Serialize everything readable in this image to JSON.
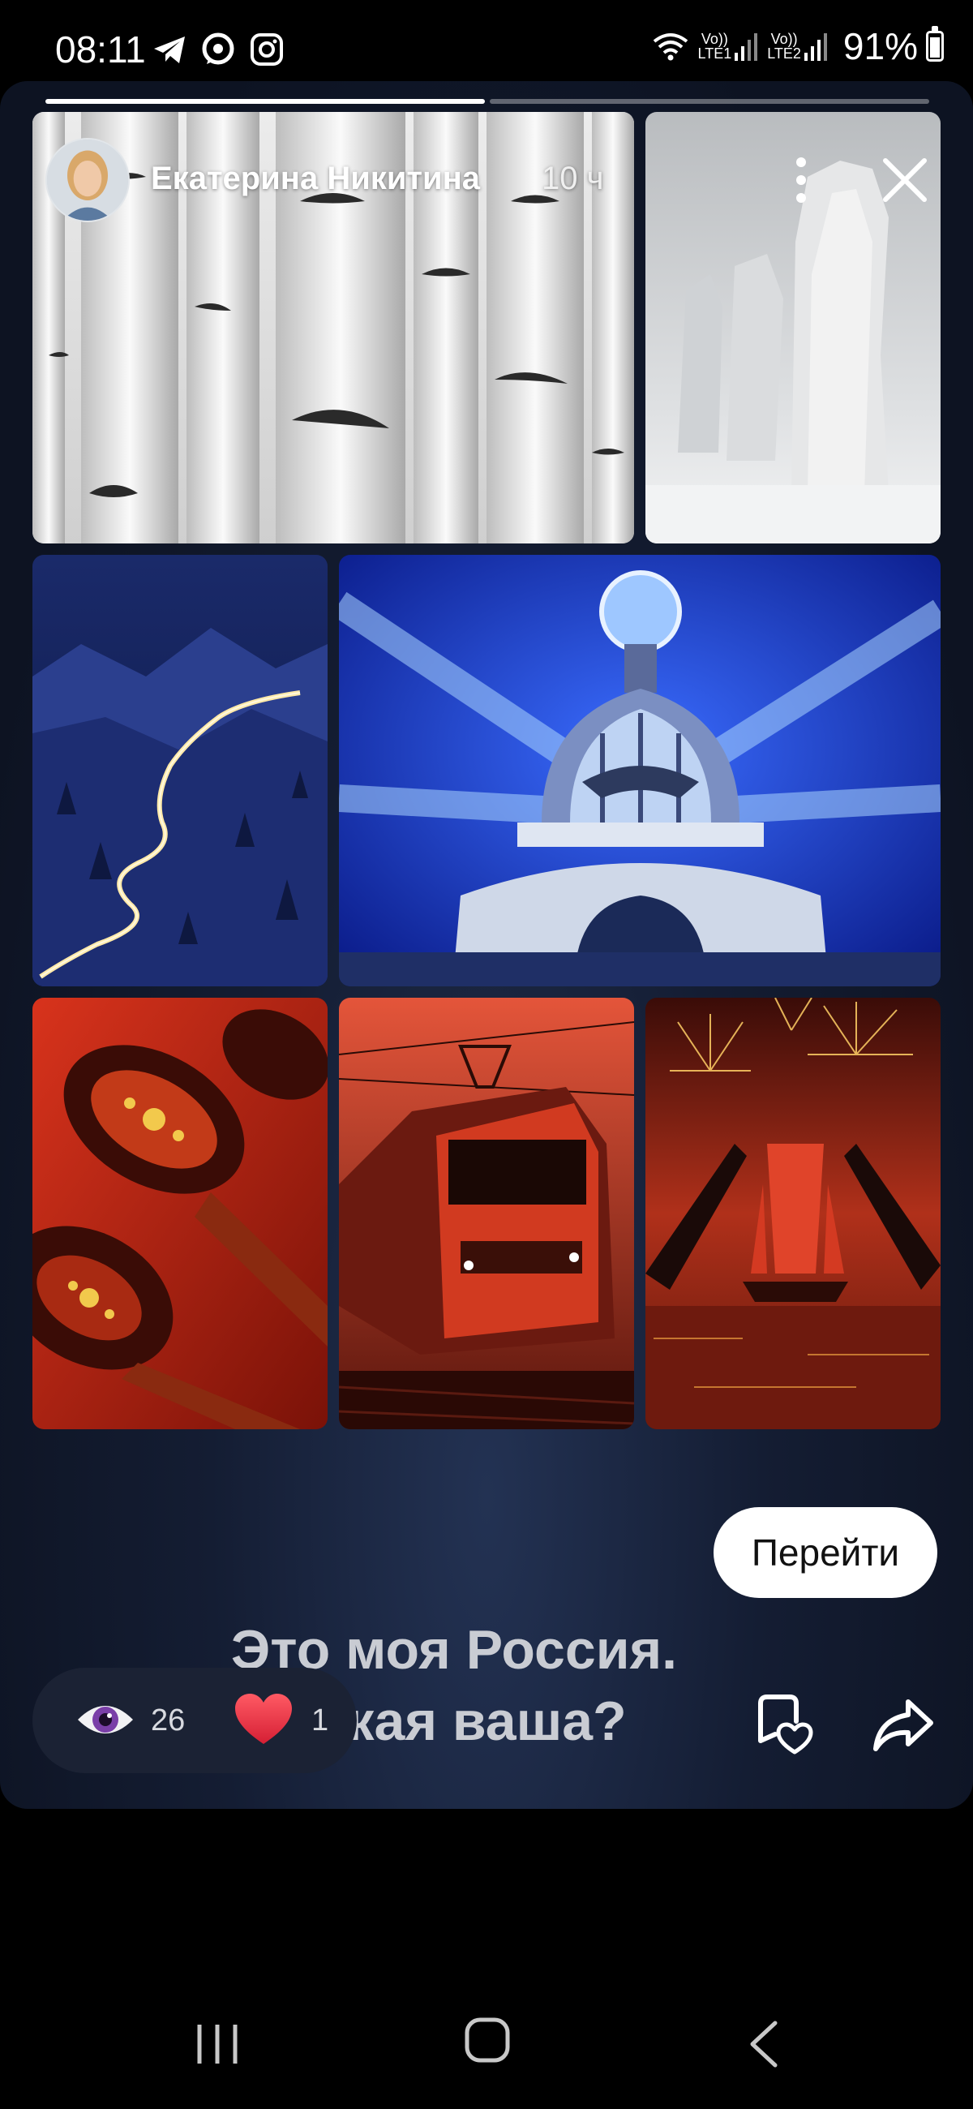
{
  "status_bar": {
    "time": "08:11",
    "app_icons": [
      "telegram-icon",
      "messenger-icon",
      "instagram-icon"
    ],
    "sim1_label_top": "Vo))",
    "sim1_label_bottom": "LTE1",
    "sim2_label_top": "Vo))",
    "sim2_label_bottom": "LTE2",
    "battery": "91%",
    "battery_level": 0.91
  },
  "story": {
    "progress": [
      1.0,
      0.0
    ],
    "author_name": "Екатерина Никитина",
    "time_ago": "10 ч",
    "caption_line1": "Это моя Россия.",
    "caption_line2": "Какая ваша?",
    "go_button_label": "Перейти",
    "views_count": "26",
    "likes_count": "1",
    "collage": [
      "birch-trees",
      "rock-pillars",
      "winter-road",
      "singer-house-dome",
      "khokhloma-spoons",
      "red-train",
      "scarlet-sails"
    ]
  },
  "colors": {
    "card_bg": "#141d33",
    "pill_bg": "#1b2234",
    "like_red": "#e8333f",
    "eye_purple": "#7a3fa8"
  },
  "navigation": {
    "icons": [
      "recent-apps-icon",
      "home-icon",
      "back-icon"
    ]
  }
}
